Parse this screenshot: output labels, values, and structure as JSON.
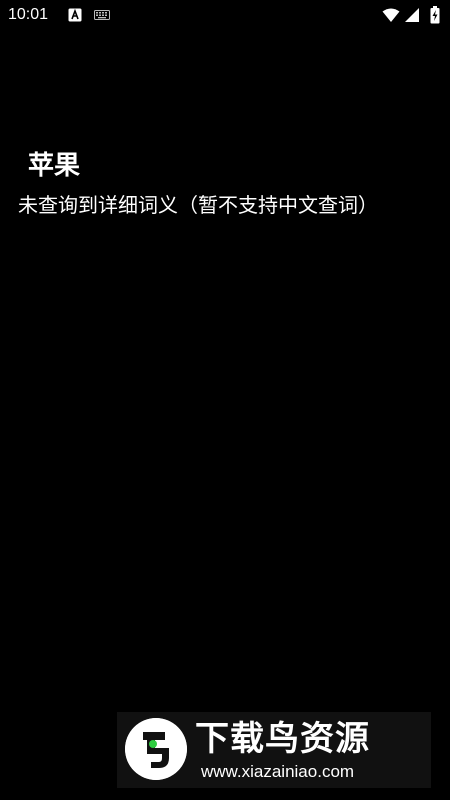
{
  "status_bar": {
    "time": "10:01",
    "icons": [
      "a-notification-icon",
      "keyboard-icon",
      "wifi-icon",
      "signal-icon",
      "battery-charging-icon"
    ]
  },
  "main": {
    "title": "苹果",
    "definition": "未查询到详细词义（暂不支持中文查词）"
  },
  "watermark": {
    "title": "下载鸟资源",
    "url": "www.xiazainiao.com"
  },
  "colors": {
    "background": "#000000",
    "text": "#ffffff",
    "logo_accent": "#2ecc40"
  }
}
